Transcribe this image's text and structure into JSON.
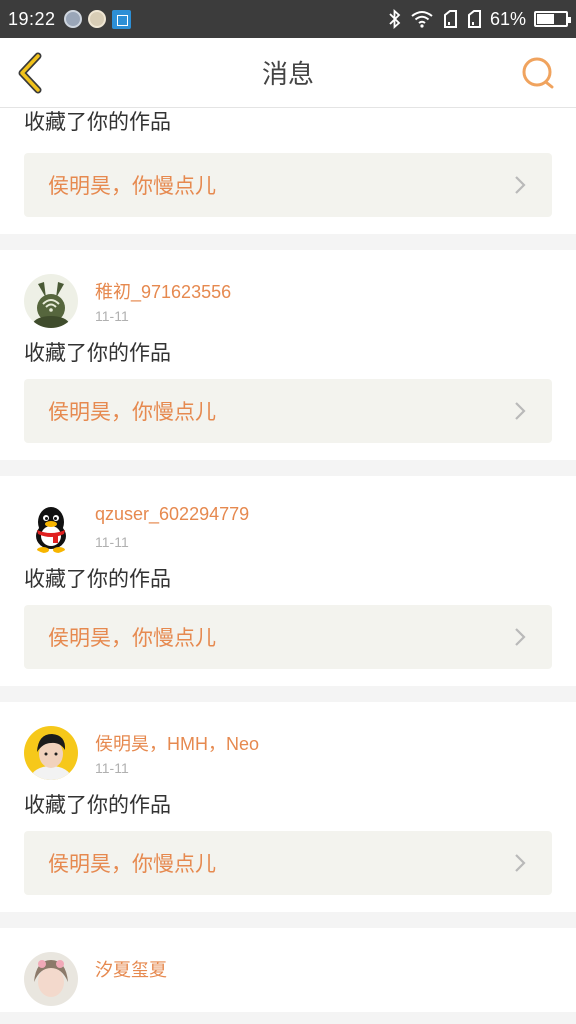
{
  "status_bar": {
    "time": "19:22",
    "battery_percent": "61%",
    "battery_level": 0.61
  },
  "header": {
    "title": "消息",
    "back_icon": "chevron-left-icon",
    "search_icon": "search-icon"
  },
  "accent_color": "#e6894f",
  "messages": [
    {
      "action": "收藏了你的作品",
      "work_title": "侯明昊，你慢点儿"
    },
    {
      "username": "稚初_971623556",
      "date": "11-11",
      "action": "收藏了你的作品",
      "work_title": "侯明昊，你慢点儿"
    },
    {
      "username": "qzuser_602294779",
      "date": "11-11",
      "action": "收藏了你的作品",
      "work_title": "侯明昊，你慢点儿"
    },
    {
      "username": "侯明昊，HMH，Neo",
      "date": "11-11",
      "action": "收藏了你的作品",
      "work_title": "侯明昊，你慢点儿"
    },
    {
      "username": "汐夏玺夏"
    }
  ]
}
